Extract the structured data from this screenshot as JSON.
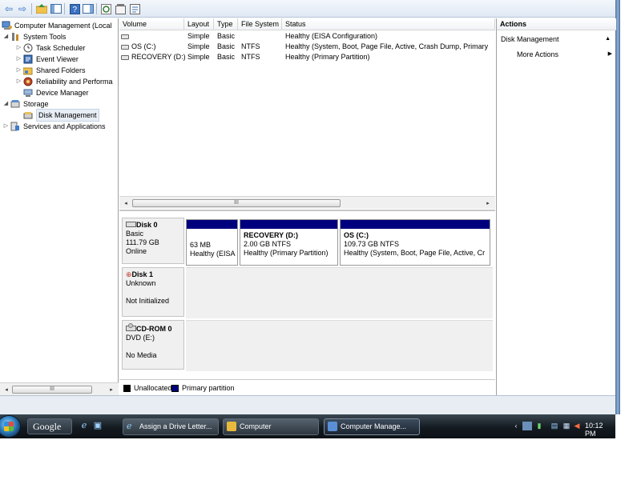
{
  "toolbar": {
    "icons": [
      "back-icon",
      "forward-icon",
      "up-folder-icon",
      "show-hide-console-tree-icon",
      "help-icon",
      "show-hide-action-pane-icon",
      "refresh-icon",
      "properties-icon",
      "export-list-icon"
    ]
  },
  "tree": {
    "items": [
      {
        "label": "Computer Management (Local",
        "icon": "computer-management-icon",
        "expand": "",
        "level": 0
      },
      {
        "label": "System Tools",
        "icon": "system-tools-icon",
        "expand": "◢",
        "level": 1
      },
      {
        "label": "Task Scheduler",
        "icon": "clock-icon",
        "expand": "▷",
        "level": 2
      },
      {
        "label": "Event Viewer",
        "icon": "event-viewer-icon",
        "expand": "▷",
        "level": 2
      },
      {
        "label": "Shared Folders",
        "icon": "shared-folder-icon",
        "expand": "▷",
        "level": 2
      },
      {
        "label": "Reliability and Performa",
        "icon": "reliability-icon",
        "expand": "▷",
        "level": 2
      },
      {
        "label": "Device Manager",
        "icon": "device-manager-icon",
        "expand": "",
        "level": 2
      },
      {
        "label": "Storage",
        "icon": "storage-icon",
        "expand": "◢",
        "level": 1
      },
      {
        "label": "Disk Management",
        "icon": "disk-management-icon",
        "expand": "",
        "level": 2,
        "selected": true
      },
      {
        "label": "Services and Applications",
        "icon": "services-icon",
        "expand": "▷",
        "level": 1
      }
    ]
  },
  "volumes": {
    "columns": [
      "Volume",
      "Layout",
      "Type",
      "File System",
      "Status"
    ],
    "rows": [
      {
        "volume": "",
        "layout": "Simple",
        "type": "Basic",
        "fs": "",
        "status": "Healthy (EISA Configuration)"
      },
      {
        "volume": "OS (C:)",
        "layout": "Simple",
        "type": "Basic",
        "fs": "NTFS",
        "status": "Healthy (System, Boot, Page File, Active, Crash Dump, Primary"
      },
      {
        "volume": "RECOVERY (D:)",
        "layout": "Simple",
        "type": "Basic",
        "fs": "NTFS",
        "status": "Healthy (Primary Partition)"
      }
    ]
  },
  "scroll": {
    "grip": "III"
  },
  "disks": [
    {
      "name": "Disk 0",
      "line1": "Basic",
      "line2": "111.79 GB",
      "line3": "Online",
      "partitions": [
        {
          "title": "",
          "size": "63 MB",
          "status": "Healthy (EISA"
        },
        {
          "title": "RECOVERY  (D:)",
          "size": "2.00 GB NTFS",
          "status": "Healthy (Primary Partition)"
        },
        {
          "title": "OS  (C:)",
          "size": "109.73 GB NTFS",
          "status": "Healthy (System, Boot, Page File, Active, Cr"
        }
      ]
    },
    {
      "name": "Disk 1",
      "line1": "Unknown",
      "line2": "",
      "line3": "Not Initialized"
    },
    {
      "name": "CD-ROM 0",
      "line1": "DVD (E:)",
      "line2": "",
      "line3": "No Media"
    }
  ],
  "legend": {
    "unallocated": "Unallocated",
    "primary": "Primary partition",
    "colors": {
      "unallocated": "#000000",
      "primary": "#00007e"
    }
  },
  "actions": {
    "title": "Actions",
    "section": "Disk Management",
    "more": "More Actions"
  },
  "taskbar": {
    "search_label": "Google",
    "windows": [
      {
        "label": "Assign a Drive Letter...",
        "icon": "internet-explorer-icon"
      },
      {
        "label": "Computer",
        "icon": "folder-icon"
      },
      {
        "label": "Computer Manage...",
        "icon": "computer-management-icon"
      }
    ],
    "clock": "10:12 PM"
  }
}
